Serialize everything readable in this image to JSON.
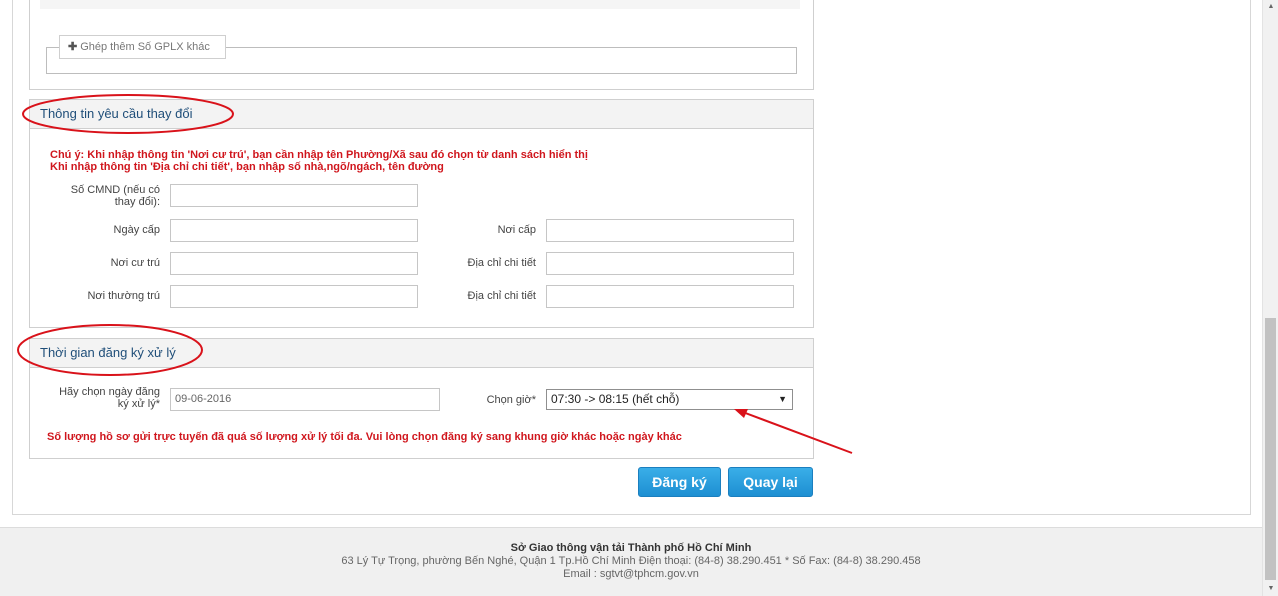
{
  "gplx": {
    "add_label": "Ghép thêm Số GPLX khác"
  },
  "change_section": {
    "title": "Thông tin yêu cầu thay đổi",
    "note_line1": "Chú ý: Khi nhập thông tin 'Nơi cư trú', bạn cần nhập tên Phường/Xã sau đó chọn từ danh sách hiển thị",
    "note_line2": "Khi nhập thông tin 'Địa chỉ chi tiết', bạn nhập số nhà,ngõ/ngách, tên đường",
    "cmnd_label_line1": "Số CMND (nếu có",
    "cmnd_label_line2": "thay đổi):",
    "issue_date_label": "Ngày cấp",
    "issue_place_label": "Nơi cấp",
    "residence_label": "Nơi cư trú",
    "residence_detail_label": "Địa chỉ chi tiết",
    "permanent_label": "Nơi thường trú",
    "permanent_detail_label": "Địa chỉ chi tiết"
  },
  "schedule_section": {
    "title": "Thời gian đăng ký xử lý",
    "date_label_line1": "Hãy chọn ngày đăng",
    "date_label_line2": "ký xử lý*",
    "date_value": "09-06-2016",
    "time_label": "Chọn giờ*",
    "time_value": "07:30 -> 08:15 (hết chỗ)",
    "warning": "Số lượng hồ sơ gửi trực tuyến đã quá số lượng xử lý tối đa. Vui lòng chọn đăng ký sang khung giờ khác hoặc ngày khác"
  },
  "buttons": {
    "register": "Đăng ký",
    "back": "Quay lại"
  },
  "footer": {
    "org": "Sở Giao thông vận tải Thành phố Hồ Chí Minh",
    "address": "63 Lý Tự Trọng, phường Bến Nghé, Quận 1 Tp.Hồ Chí Minh Điện thoại: (84-8) 38.290.451 * Số Fax: (84-8) 38.290.458",
    "email": "Email : sgtvt@tphcm.gov.vn"
  },
  "icons": {
    "add": "plus-icon",
    "dropdown": "chevron-down-icon"
  },
  "colors": {
    "accent": "#1e8fd2",
    "warning": "#d0161d",
    "annotation": "#d9121a",
    "heading": "#1f4e79"
  }
}
